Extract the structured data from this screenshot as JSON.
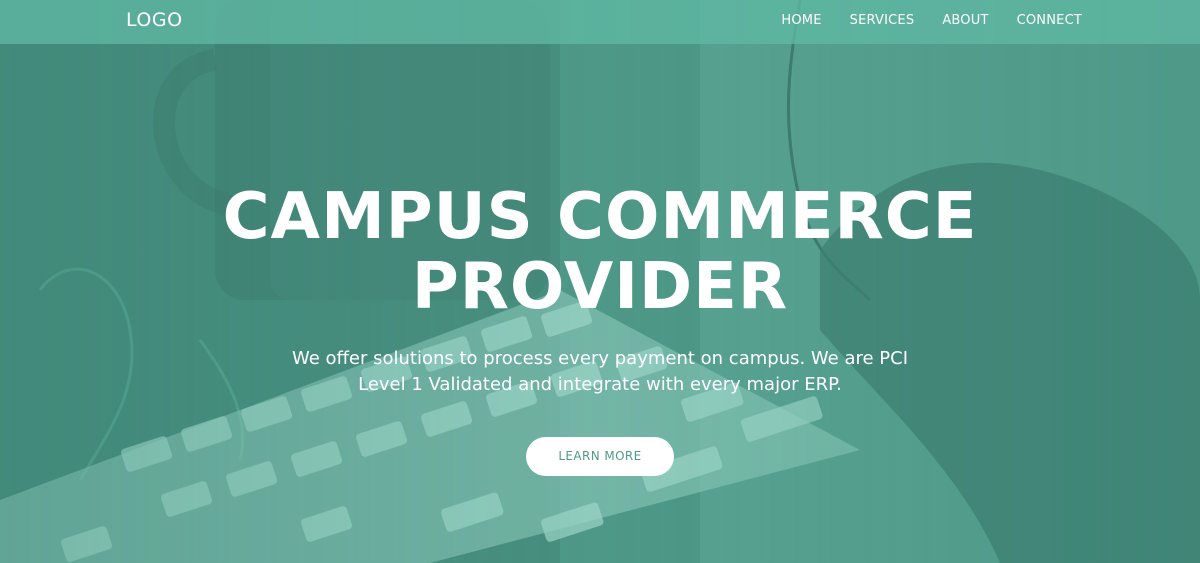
{
  "nav": {
    "logo": "LOGO",
    "links": [
      "HOME",
      "SERVICES",
      "ABOUT",
      "CONNECT"
    ]
  },
  "hero": {
    "title_line1": "CAMPUS COMMERCE",
    "title_line2": "PROVIDER",
    "subtitle": "We offer solutions to process every payment on campus. We are PCI Level 1 Validated and integrate with every major ERP.",
    "cta_label": "LEARN MORE"
  },
  "colors": {
    "accent": "#5fb9a3",
    "overlay": "#4f9a8a",
    "text": "#ffffff"
  },
  "icons": {
    "background_image": "desk-photo-mug-keyboard-hand"
  }
}
